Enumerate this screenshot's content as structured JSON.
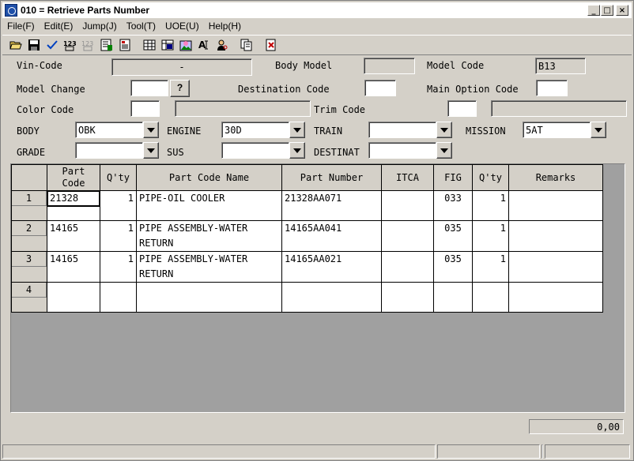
{
  "window": {
    "title": "010 = Retrieve Parts Number",
    "btn_min": "_",
    "btn_max": "□",
    "btn_close": "×"
  },
  "menu": [
    "File(F)",
    "Edit(E)",
    "Jump(J)",
    "Tool(T)",
    "UOE(U)",
    "Help(H)"
  ],
  "toolbar": {
    "groups": [
      [
        "open-folder-icon",
        "save-disk-icon",
        "check-icon",
        "numbers-123-icon",
        "numbers-disabled-icon",
        "list-export-icon",
        "document-list-icon"
      ],
      [
        "grid-icon",
        "grid-select-icon",
        "image-icon",
        "text-insert-icon",
        "user-search-icon"
      ],
      [
        "copy-pages-icon"
      ],
      [
        "exit-icon"
      ]
    ]
  },
  "form": {
    "vin_code": {
      "label": "Vin-Code",
      "value": "-"
    },
    "body_model": {
      "label": "Body Model",
      "value": ""
    },
    "model_code": {
      "label": "Model Code",
      "value": "B13"
    },
    "model_change": {
      "label": "Model Change",
      "value": "",
      "button": "?"
    },
    "destination_code": {
      "label": "Destination Code",
      "value": ""
    },
    "main_option_code": {
      "label": "Main Option Code",
      "value": ""
    },
    "color_code": {
      "label": "Color Code",
      "value": "",
      "desc": ""
    },
    "trim_code": {
      "label": "Trim Code",
      "value": "",
      "desc": ""
    },
    "body": {
      "label": "BODY",
      "value": "OBK"
    },
    "engine": {
      "label": "ENGINE",
      "value": "30D"
    },
    "train": {
      "label": "TRAIN",
      "value": ""
    },
    "mission": {
      "label": "MISSION",
      "value": "5AT"
    },
    "grade": {
      "label": "GRADE",
      "value": ""
    },
    "sus": {
      "label": "SUS",
      "value": ""
    },
    "destinat": {
      "label": "DESTINAT",
      "value": ""
    }
  },
  "grid": {
    "headers": {
      "part_code_1": "Part",
      "part_code_2": "Code",
      "qty": "Q'ty",
      "part_code_name": "Part Code Name",
      "part_number": "Part Number",
      "itca": "ITCA",
      "fig": "FIG",
      "qty2": "Q'ty",
      "remarks": "Remarks"
    },
    "rows": [
      {
        "num": "1",
        "part_code": "21328",
        "qty": "1",
        "name1": "PIPE-OIL COOLER",
        "name2": "",
        "part_number": "21328AA071",
        "itca": "",
        "fig": "033",
        "qty2": "1",
        "remarks": ""
      },
      {
        "num": "2",
        "part_code": "14165",
        "qty": "1",
        "name1": "PIPE ASSEMBLY-WATER",
        "name2": "RETURN",
        "part_number": "14165AA041",
        "itca": "",
        "fig": "035",
        "qty2": "1",
        "remarks": ""
      },
      {
        "num": "3",
        "part_code": "14165",
        "qty": "1",
        "name1": "PIPE ASSEMBLY-WATER",
        "name2": "RETURN",
        "part_number": "14165AA021",
        "itca": "",
        "fig": "035",
        "qty2": "1",
        "remarks": ""
      },
      {
        "num": "4",
        "part_code": "",
        "qty": "",
        "name1": "",
        "name2": "",
        "part_number": "",
        "itca": "",
        "fig": "",
        "qty2": "",
        "remarks": ""
      }
    ]
  },
  "total": "0,00",
  "status": [
    "",
    "",
    "",
    ""
  ]
}
